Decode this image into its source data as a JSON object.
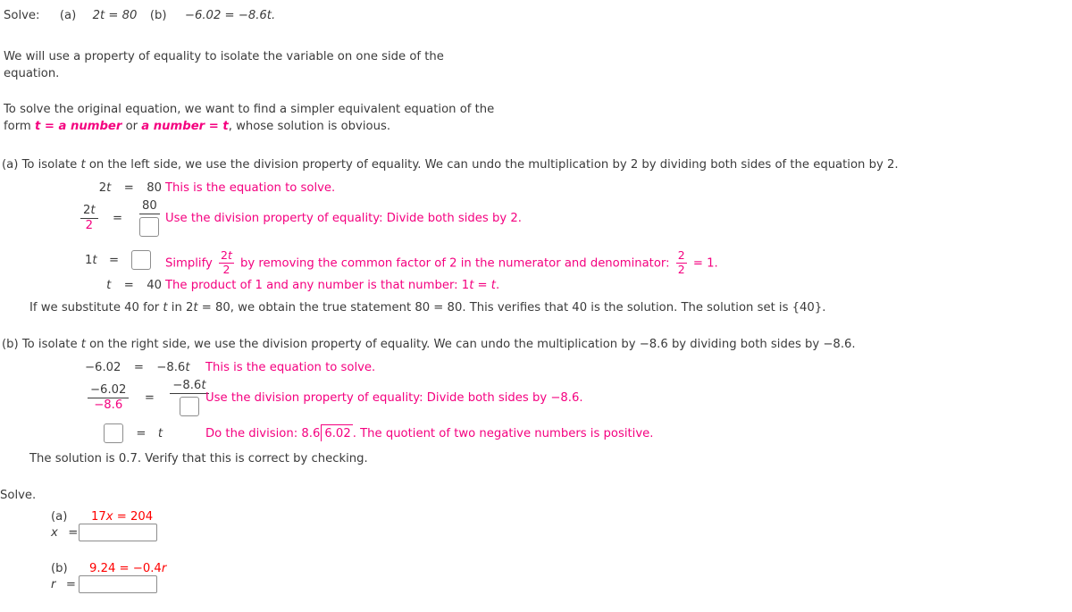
{
  "header": {
    "solve_label": "Solve:",
    "part_a_tag": "(a)",
    "part_a_eq": "2t = 80",
    "part_b_tag": "(b)",
    "part_b_eq": "−6.02 = −8.6t."
  },
  "intro": {
    "line1": "We will use a property of equality to isolate the variable on one side of the",
    "line2": "equation.",
    "line3": "To solve the original equation, we want to find a simpler equivalent equation of the",
    "line4_pre": "form ",
    "line4_bold1": "t = a number",
    "line4_mid": " or ",
    "line4_bold2": "a number = t",
    "line4_post": ", whose solution is obvious."
  },
  "part_a": {
    "intro": "(a)  To isolate t on the left side, we use the division property of equality. We can undo the multiplication by 2 by dividing both sides of the equation by 2.",
    "intro_tag": "(a)  To isolate ",
    "intro_var": "t",
    "intro_rest": " on the left side, we use the division property of equality. We can undo the multiplication by 2 by dividing both sides of the equation by 2.",
    "step1": {
      "lhs_coef": "2",
      "lhs_var": "t",
      "eq": "=",
      "rhs": "80",
      "note": "This is the equation to solve."
    },
    "step2": {
      "num_coef": "2",
      "num_var": "t",
      "den": "2",
      "eq": "=",
      "rhs_num": "80",
      "rhs_den_box": "",
      "note": "Use the division property of equality: Divide both sides by 2."
    },
    "step3": {
      "lhs_coef": "1",
      "lhs_var": "t",
      "eq": "=",
      "rhs_box": "",
      "note_pre": "Simplify ",
      "note_frac_num_coef": "2",
      "note_frac_num_var": "t",
      "note_frac_den": "2",
      "note_mid": " by removing the common factor of 2 in the numerator and denominator: ",
      "note_frac2_num": "2",
      "note_frac2_den": "2",
      "note_post": " = 1."
    },
    "step4": {
      "lhs_var": "t",
      "eq": "=",
      "rhs": "40",
      "note_pre": "The product of 1 and any number is that number: 1",
      "note_var1": "t",
      "note_mid": " = ",
      "note_var2": "t",
      "note_post": "."
    },
    "verify": "If we substitute 40 for t in 2t = 80, we obtain the true statement 80 = 80. This verifies that 40 is the solution. The solution set is {40}.",
    "verify_p1": "If we substitute 40 for ",
    "verify_v1": "t",
    "verify_p2": " in 2",
    "verify_v2": "t",
    "verify_p3": " = 80, we obtain the true statement 80 = 80. This verifies that 40 is the solution. The solution set is {40}."
  },
  "part_b": {
    "intro_tag": "(b)  To isolate ",
    "intro_var": "t",
    "intro_rest": " on the right side, we use the division property of equality. We can undo the multiplication by −8.6 by dividing both sides by −8.6.",
    "step1": {
      "lhs": "−6.02",
      "eq": "=",
      "rhs_coef": "−8.6",
      "rhs_var": "t",
      "note": "This is the equation to solve."
    },
    "step2": {
      "num": "−6.02",
      "den": "−8.6",
      "eq": "=",
      "rhs_num_coef": "−8.6",
      "rhs_num_var": "t",
      "rhs_den_box": "",
      "note": "Use the division property of equality: Divide both sides by −8.6."
    },
    "step3": {
      "lhs_box": "",
      "eq": "=",
      "rhs_var": "t",
      "note_pre": "Do the division:  ",
      "divisor": "8.6",
      "dividend": "6.02",
      "note_post": ".  The quotient of two negative numbers is positive."
    },
    "solution_line": "The solution is 0.7. Verify that this is correct by checking."
  },
  "exercise": {
    "heading": "Solve.",
    "items": [
      {
        "tag": "(a)",
        "equation_coef": "17",
        "equation_var": "x",
        "equation_rest": " = 204",
        "equation_full": "17x = 204",
        "answer_var": "x",
        "answer_eq": "=",
        "answer_value": "",
        "answer_placeholder": ""
      },
      {
        "tag": "(b)",
        "equation_full": "9.24 = −0.4r",
        "equation_lead": "9.24 = −0.4",
        "equation_var": "r",
        "answer_var": "r",
        "answer_eq": "=",
        "answer_value": "",
        "answer_placeholder": ""
      }
    ]
  },
  "colors": {
    "annotation_pink": "#f4007f",
    "exercise_red": "#fe0000",
    "body_text": "#3b3b3b",
    "box_border": "#8d8d8d"
  }
}
